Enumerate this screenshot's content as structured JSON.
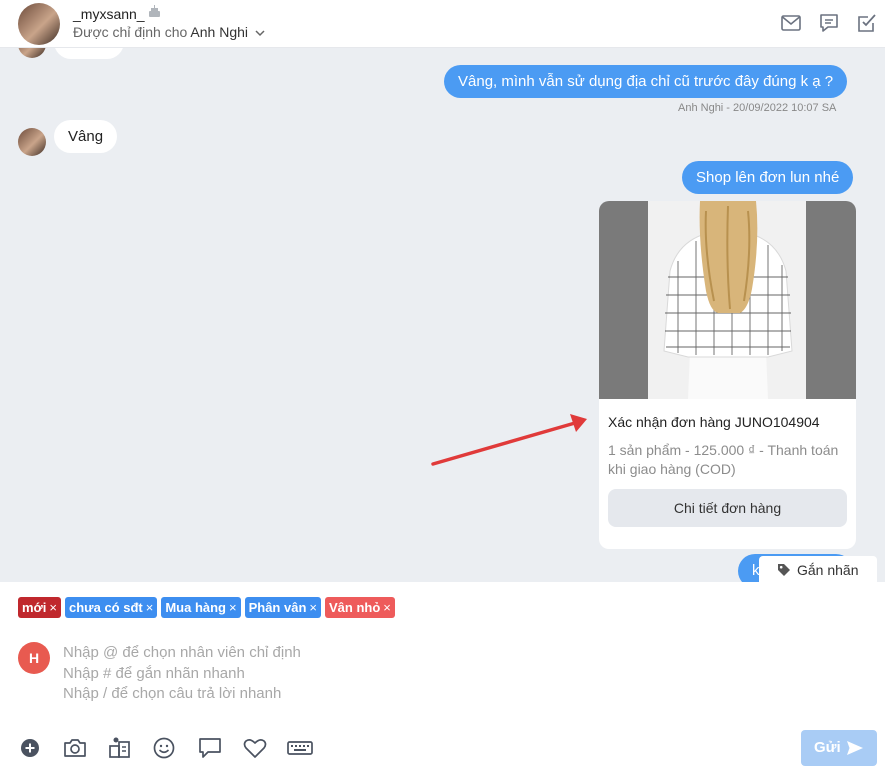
{
  "header": {
    "username": "_myxsann_",
    "assigned_prefix": "Được chỉ định cho",
    "assignee": "Anh Nghi",
    "icons": [
      "mail-icon",
      "chat-icon",
      "checkbox-icon"
    ]
  },
  "messages": {
    "out_1": "Vâng, mình vẫn sử dụng địa chỉ cũ trước đây đúng k ạ ?",
    "out_1_meta": "Anh Nghi - 20/09/2022 10:07 SA",
    "in_1": "Vâng",
    "out_2": "Shop lên đơn lun nhé",
    "out_3_partial": "k"
  },
  "order": {
    "title": "Xác nhận đơn hàng JUNO104904",
    "description": "1 sản phẩm - 125.000 ₫ - Thanh toán khi giao hàng (COD)",
    "button": "Chi tiết đơn hàng"
  },
  "tag_button": "Gắn nhãn",
  "labels": [
    {
      "text": "mới",
      "color": "#c0282d"
    },
    {
      "text": "chưa có sđt",
      "color": "#3d8ef0"
    },
    {
      "text": "Mua hàng",
      "color": "#3d8ef0"
    },
    {
      "text": "Phân vân",
      "color": "#3d8ef0"
    },
    {
      "text": "Vân nhỏ",
      "color": "#ee5b5b"
    }
  ],
  "composer": {
    "avatar_letter": "H",
    "placeholder": "Nhập @ để chọn nhân viên chỉ định\nNhập # để gắn nhãn nhanh\nNhập / để chọn câu trả lời nhanh",
    "value": ""
  },
  "send_label": "Gửi",
  "colors": {
    "primary": "#4b9bf3",
    "chat_bg": "#ebeef2",
    "send_disabled": "#a9ccf5",
    "arrow": "#e03a3a"
  }
}
